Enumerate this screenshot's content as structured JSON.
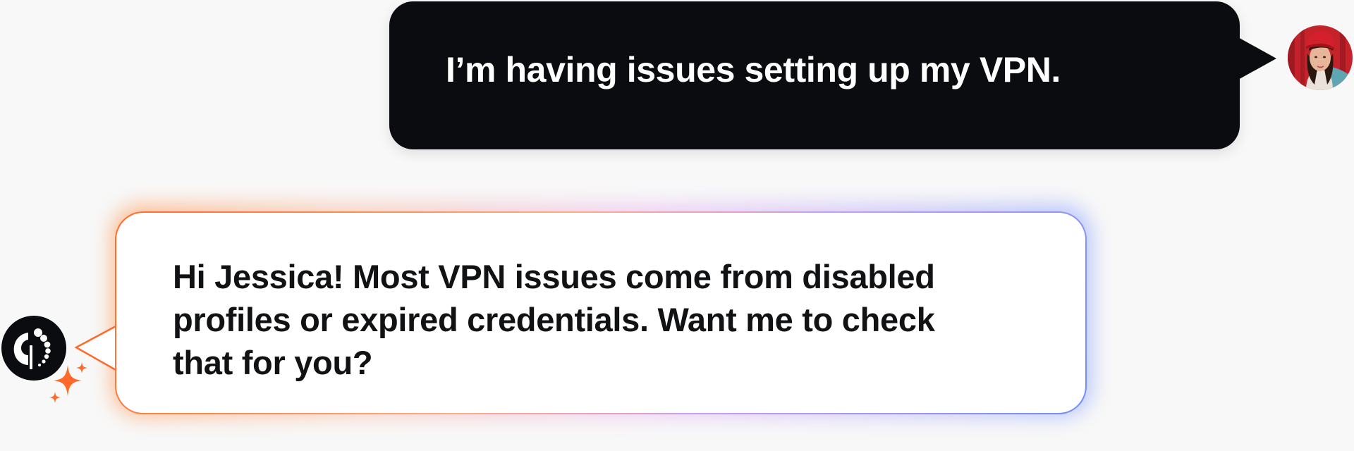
{
  "conversation": {
    "user_message": {
      "text": "I’m having issues setting up my VPN.",
      "avatar_icon": "user-photo-avatar"
    },
    "assistant_message": {
      "text": "Hi Jessica! Most VPN issues come from disabled profiles or expired credentials. Want me to check that for you?",
      "avatar_icon": "assistant-logo-icon",
      "badge_icon": "sparkles-icon"
    }
  },
  "colors": {
    "page_background": "#f8f8f8",
    "user_bubble": "#0b0c0f",
    "assistant_bubble": "#ffffff",
    "accent_orange": "#ff6a2b",
    "accent_blue": "#6e8cff"
  }
}
